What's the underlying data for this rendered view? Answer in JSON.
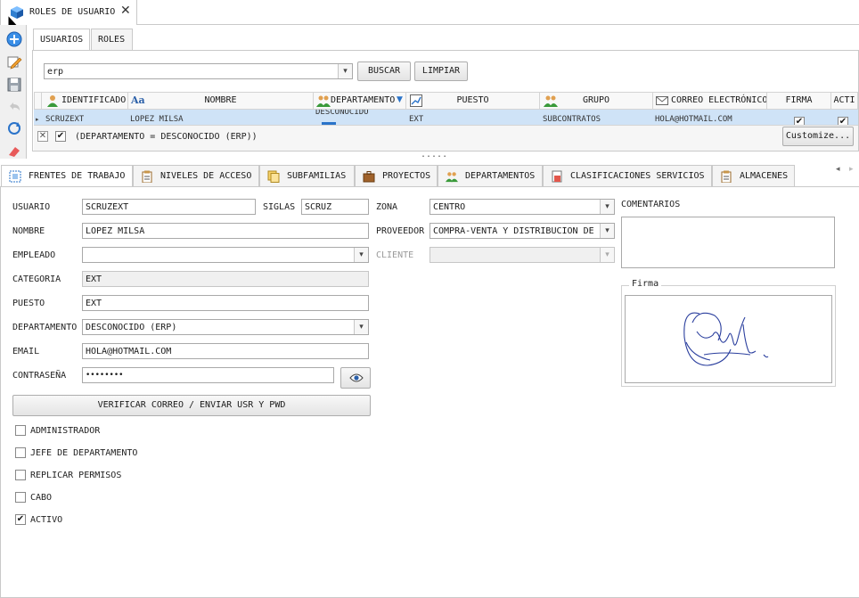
{
  "doc_tab": {
    "title": "ROLES DE USUARIO",
    "close": "✕"
  },
  "sub_tabs": [
    {
      "label": "USUARIOS"
    },
    {
      "label": "ROLES"
    }
  ],
  "search": {
    "value": "erp",
    "buscar": "BUSCAR",
    "limpiar": "LIMPIAR"
  },
  "grid": {
    "headers": [
      "IDENTIFICADO",
      "NOMBRE",
      "DEPARTAMENTO",
      "PUESTO",
      "GRUPO",
      "CORREO ELECTRÓNICO",
      "FIRMA",
      "ACTI"
    ],
    "row": [
      "SCRUZEXT",
      "LOPEZ MILSA",
      "DESCONOCIDO",
      "EXT",
      "SUBCONTRATOS",
      "HOLA@HOTMAIL.COM"
    ],
    "filter": "(DEPARTAMENTO = DESCONOCIDO (ERP))",
    "customize": "Customize..."
  },
  "splitter": ".....",
  "bottom_tabs": [
    {
      "label": "FRENTES DE TRABAJO"
    },
    {
      "label": "NIVELES DE ACCESO"
    },
    {
      "label": "SUBFAMILIAS"
    },
    {
      "label": "PROYECTOS"
    },
    {
      "label": "DEPARTAMENTOS"
    },
    {
      "label": "CLASIFICACIONES SERVICIOS"
    },
    {
      "label": "ALMACENES"
    }
  ],
  "form": {
    "usuario_label": "USUARIO",
    "usuario": "SCRUZEXT",
    "siglas_label": "SIGLAS",
    "siglas": "SCRUZ",
    "zona_label": "ZONA",
    "zona": "CENTRO",
    "comentarios_label": "COMENTARIOS",
    "nombre_label": "NOMBRE",
    "nombre": "LOPEZ MILSA",
    "proveedor_label": "PROVEEDOR",
    "proveedor": "COMPRA-VENTA Y DISTRIBUCION DE",
    "empleado_label": "EMPLEADO",
    "empleado": "",
    "cliente_label": "CLIENTE",
    "cliente": "",
    "categoria_label": "CATEGORIA",
    "categoria": "EXT",
    "puesto_label": "PUESTO",
    "puesto": "EXT",
    "departamento_label": "DEPARTAMENTO",
    "departamento": "DESCONOCIDO (ERP)",
    "email_label": "EMAIL",
    "email": "HOLA@HOTMAIL.COM",
    "password_label": "CONTRASEÑA",
    "password": "••••••••",
    "verify_button": "VERIFICAR CORREO / ENVIAR USR Y PWD",
    "firma_label": "Firma"
  },
  "checks": [
    {
      "label": "ADMINISTRADOR",
      "checked": false
    },
    {
      "label": "JEFE DE DEPARTAMENTO",
      "checked": false
    },
    {
      "label": "REPLICAR PERMISOS",
      "checked": false
    },
    {
      "label": "CABO",
      "checked": false
    },
    {
      "label": "ACTIVO",
      "checked": true
    }
  ]
}
